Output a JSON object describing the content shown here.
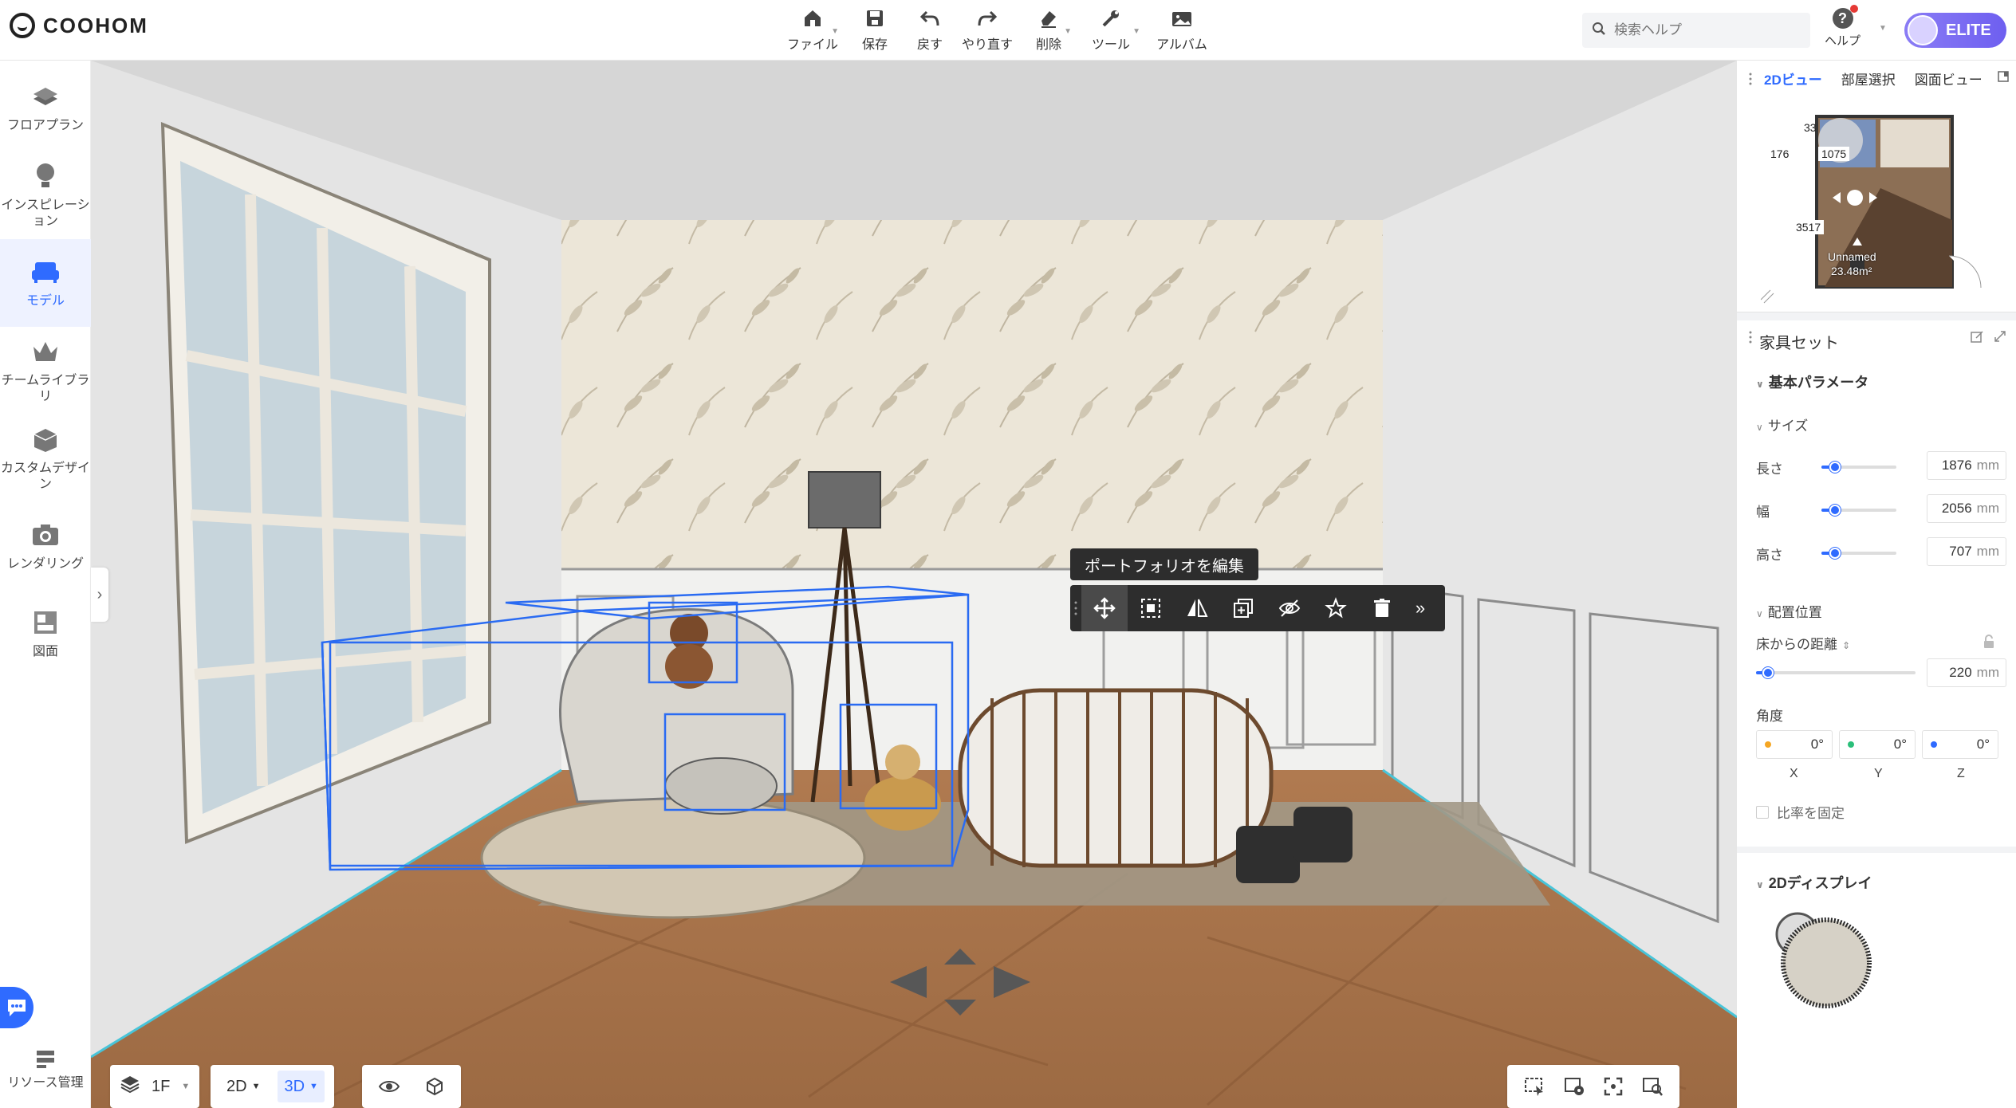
{
  "app": {
    "logo": "COOHOM"
  },
  "toolbar": {
    "file": "ファイル",
    "save": "保存",
    "undo": "戻す",
    "redo": "やり直す",
    "delete": "削除",
    "tools": "ツール",
    "album": "アルバム"
  },
  "search": {
    "placeholder": "検索ヘルプ"
  },
  "help": {
    "label": "ヘルプ"
  },
  "account": {
    "badge": "ELITE"
  },
  "sidebar": {
    "items": [
      {
        "label": "フロアプラン",
        "icon": "floorplan-icon"
      },
      {
        "label": "インスピレーション",
        "icon": "lightbulb-icon"
      },
      {
        "label": "モデル",
        "icon": "sofa-icon",
        "active": true
      },
      {
        "label": "チームライブラリ",
        "icon": "crown-icon"
      },
      {
        "label": "カスタムデザイン",
        "icon": "box-icon"
      },
      {
        "label": "レンダリング",
        "icon": "camera-icon"
      },
      {
        "label": "図面",
        "icon": "drawing-icon"
      }
    ],
    "resource": "リソース管理"
  },
  "viewport": {
    "tooltip": "ポートフォリオを編集",
    "floor_label": "1F",
    "view_2d": "2D",
    "view_3d": "3D"
  },
  "minimap": {
    "tabs": [
      "2Dビュー",
      "部屋選択",
      "図面ビュー"
    ],
    "active_tab": "2Dビュー",
    "dims": {
      "top": "33",
      "left": "176",
      "right": "1075",
      "bottom": "3517"
    },
    "room_name": "Unnamed",
    "room_area": "23.48m²"
  },
  "props": {
    "title": "家具セット",
    "basic": "基本パラメータ",
    "size": "サイズ",
    "length_label": "長さ",
    "length_value": "1876",
    "width_label": "幅",
    "width_value": "2056",
    "height_label": "高さ",
    "height_value": "707",
    "unit": "mm",
    "placement": "配置位置",
    "floor_dist_label": "床からの距離",
    "floor_dist_value": "220",
    "angle_label": "角度",
    "angle_x": "0",
    "angle_y": "0",
    "angle_z": "0",
    "axis_x": "X",
    "axis_y": "Y",
    "axis_z": "Z",
    "lock_ratio": "比率を固定",
    "display2d": "2Dディスプレイ"
  },
  "colors": {
    "accent": "#2f6bff",
    "elite": "#7a6cf3",
    "floor": "#a8714a",
    "wall": "#e8e8e8"
  }
}
